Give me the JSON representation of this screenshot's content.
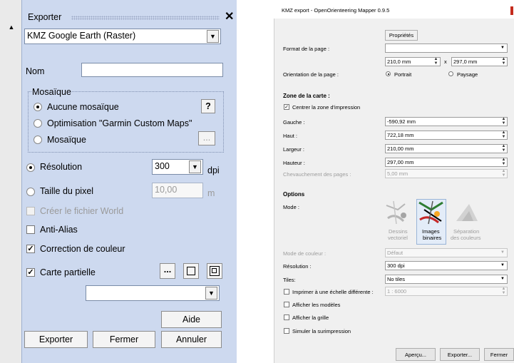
{
  "left": {
    "title": "Exporter",
    "close_icon": "close-icon",
    "format": "KMZ Google Earth (Raster)",
    "nom_label": "Nom",
    "nom_value": "",
    "mosaic_group": "Mosaïque",
    "mosaic_opt1": "Aucune mosaïque",
    "mosaic_opt2": "Optimisation \"Garmin Custom Maps\"",
    "mosaic_opt3": "Mosaïque",
    "help_q": "?",
    "ellipsis": "...",
    "resolution_label": "Résolution",
    "resolution_value": "300",
    "dpi": "dpi",
    "pixel_label": "Taille du pixel",
    "pixel_value": "10,00",
    "pixel_unit": "m",
    "world_label": "Créer le fichier World",
    "antialias_label": "Anti-Alias",
    "color_label": "Correction de couleur",
    "partial_label": "Carte partielle",
    "partial_dd": "",
    "aide": "Aide",
    "exporter": "Exporter",
    "fermer": "Fermer",
    "annuler": "Annuler"
  },
  "right": {
    "title": "KMZ export - OpenOrienteering Mapper 0.9.5",
    "proprietes": "Propriétés",
    "format_label": "Format de la page :",
    "format_value": "",
    "width": "210,0 mm",
    "x": "x",
    "height": "297,0 mm",
    "orientation_label": "Orientation de la page :",
    "portrait": "Portrait",
    "paysage": "Paysage",
    "zone_header": "Zone de la carte :",
    "centrer": "Centrer la zone d'impression",
    "gauche_label": "Gauche :",
    "gauche": "-590,92 mm",
    "haut_label": "Haut :",
    "haut": "722,18 mm",
    "largeur_label": "Largeur :",
    "largeur": "210,00 mm",
    "hauteur_label": "Hauteur :",
    "hauteur": "297,00 mm",
    "chev_label": "Chevauchement des pages :",
    "chev": "5,00 mm",
    "options_header": "Options",
    "mode_label": "Mode :",
    "mode1a": "Dessins",
    "mode1b": "vectoriel",
    "mode2a": "Images",
    "mode2b": "binaires",
    "mode3a": "Séparation",
    "mode3b": "des couleurs",
    "couleur_label": "Mode de couleur :",
    "couleur": "Défaut",
    "res_label": "Résolution :",
    "res": "300 dpi",
    "tiles_label": "Tiles:",
    "tiles": "No tiles",
    "echelle_label": "Imprimer à une échelle différente :",
    "echelle": "1 : 6000",
    "modeles": "Afficher les modèles",
    "grille": "Afficher la grille",
    "surimp": "Simuler la surimpression",
    "apercu": "Aperçu...",
    "exporter": "Exporter...",
    "fermer": "Fermer"
  }
}
